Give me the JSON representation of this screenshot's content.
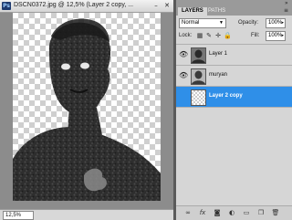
{
  "document": {
    "title": "DSCN0372.jpg @ 12,5% (Layer 2 copy, ...",
    "app_icon_text": "Ps",
    "minimize_glyph": "–",
    "close_glyph": "✕",
    "zoom": "12,5%"
  },
  "panel": {
    "tabs": [
      {
        "label": "LAYERS",
        "active": true
      },
      {
        "label": "PATHS",
        "active": false
      }
    ],
    "blend_mode": "Normal",
    "opacity_label": "Opacity:",
    "opacity_value": "100%",
    "lock_label": "Lock:",
    "fill_label": "Fill:",
    "fill_value": "100%",
    "menu_glyph": "≡",
    "close_glyph": "»",
    "layers": [
      {
        "name": "Layer 1",
        "selected": false,
        "visible": true,
        "thumb": "photo"
      },
      {
        "name": "muryan",
        "selected": false,
        "visible": true,
        "thumb": "photo"
      },
      {
        "name": "Layer 2 copy",
        "selected": true,
        "visible": false,
        "thumb": "transparent"
      }
    ],
    "footer_icons": [
      "link-icon",
      "fx-icon",
      "mask-icon",
      "adjustment-icon",
      "folder-icon",
      "new-layer-icon",
      "trash-icon"
    ]
  },
  "colors": {
    "selection": "#2f8fe8",
    "canvas_bg": "#8c8c8c",
    "panel_bg": "#d6d6d6"
  }
}
